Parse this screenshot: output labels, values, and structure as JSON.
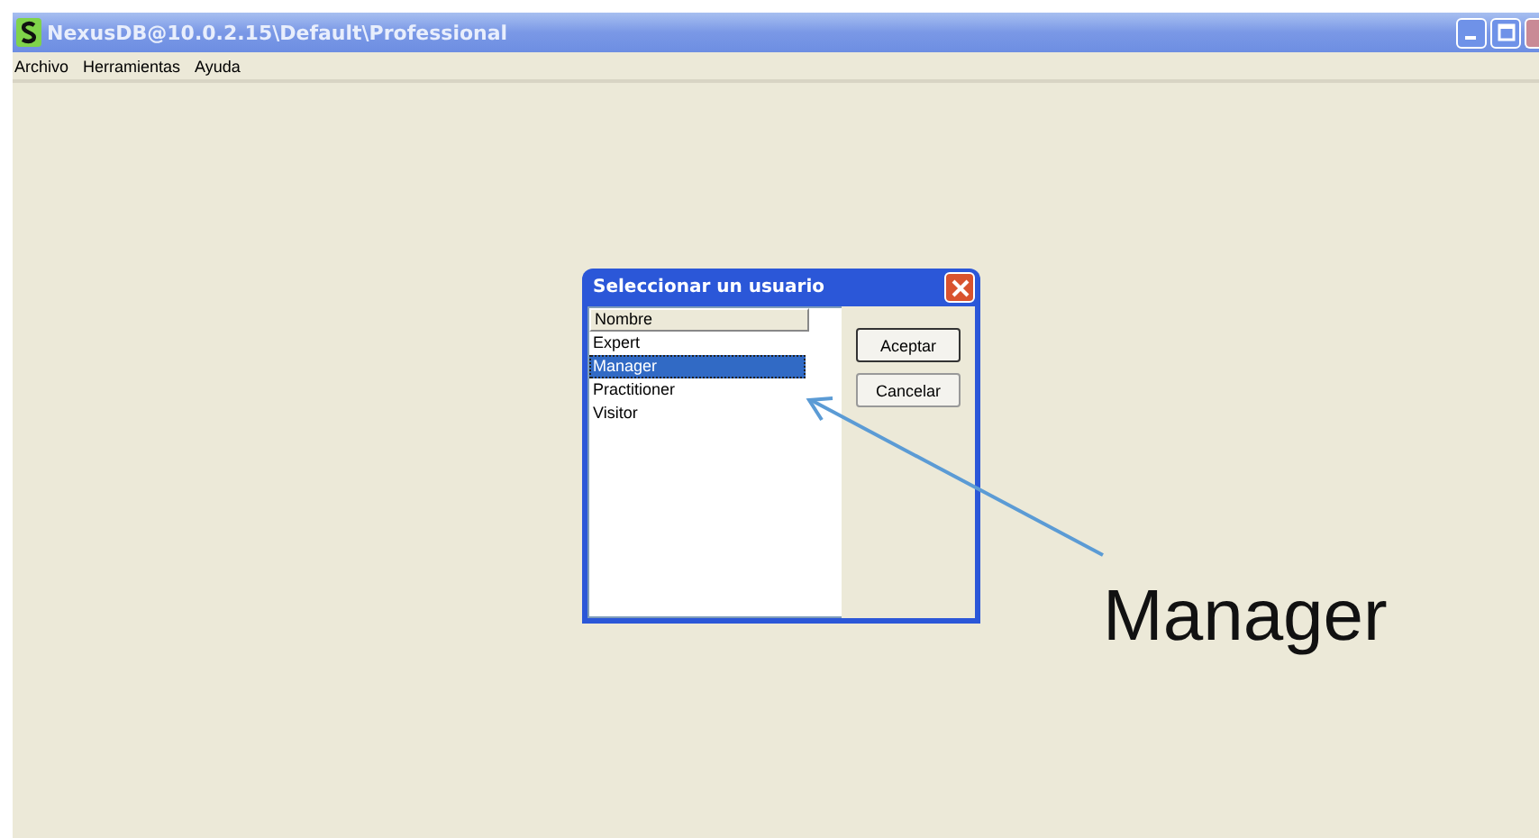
{
  "window": {
    "title": "NexusDB@10.0.2.15\\Default\\Professional"
  },
  "menu": [
    "Archivo",
    "Herramientas",
    "Ayuda"
  ],
  "dialog": {
    "title": "Seleccionar un usuario",
    "column": "Nombre",
    "users": [
      {
        "name": "Expert",
        "selected": false
      },
      {
        "name": "Manager",
        "selected": true
      },
      {
        "name": "Practitioner",
        "selected": false
      },
      {
        "name": "Visitor",
        "selected": false
      }
    ],
    "buttons": [
      {
        "label": "Aceptar",
        "default": true
      },
      {
        "label": "Cancelar",
        "default": false
      }
    ]
  },
  "annotation": "Manager"
}
